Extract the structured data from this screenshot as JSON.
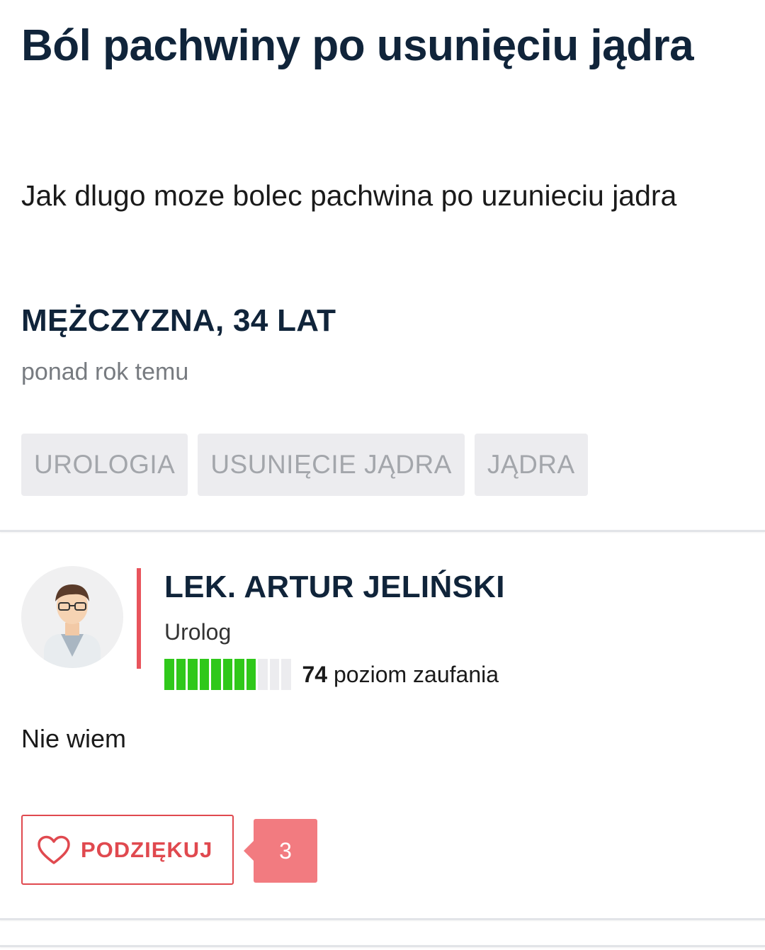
{
  "question": {
    "title": "Ból pachwiny po usunięciu jądra",
    "body": "Jak dlugo moze bolec pachwina po uzunieciu jadra",
    "author_meta": "MĘŻCZYZNA, 34 LAT",
    "posted": "ponad rok temu",
    "tags": [
      "UROLOGIA",
      "USUNIĘCIE JĄDRA",
      "JĄDRA"
    ]
  },
  "answer": {
    "doctor_name": "LEK. ARTUR JELIŃSKI",
    "specialty": "Urolog",
    "trust_level": 74,
    "trust_label": "poziom zaufania",
    "trust_segments_filled": 8,
    "trust_segments_total": 11,
    "text": "Nie wiem",
    "thanks_label": "PODZIĘKUJ",
    "thanks_count": "3",
    "icons": {
      "avatar": "doctor-avatar",
      "thanks": "heart-icon"
    }
  },
  "colors": {
    "heading": "#10243a",
    "accent_red": "#e0494f",
    "badge_red": "#f27b80",
    "trust_green": "#2fc81a",
    "tag_bg": "#ececef"
  }
}
